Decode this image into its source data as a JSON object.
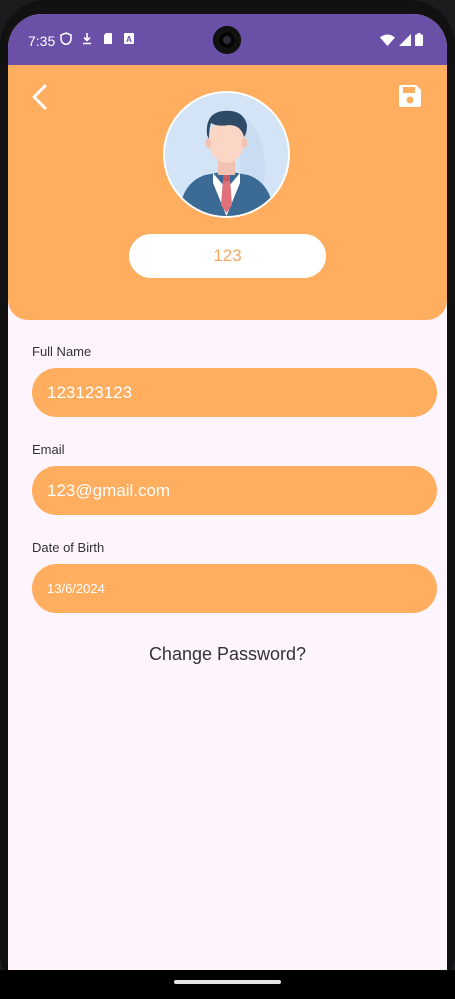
{
  "status_bar": {
    "time": "7:35",
    "left_icons": [
      "shield-icon",
      "download-icon",
      "sd-card-icon",
      "a-icon"
    ],
    "right_icons": [
      "wifi-icon",
      "signal-icon",
      "battery-icon"
    ],
    "color": "#6a50a7"
  },
  "header": {
    "color": "#ffad5e",
    "back_icon": "chevron-left-icon",
    "save_icon": "save-icon",
    "avatar": "businessman-avatar",
    "username": "123"
  },
  "form": {
    "full_name": {
      "label": "Full Name",
      "value": "123123123"
    },
    "email": {
      "label": "Email",
      "value": "123@gmail.com"
    },
    "dob": {
      "label": "Date of Birth",
      "value": "13/6/2024"
    }
  },
  "change_password_label": "Change Password?"
}
